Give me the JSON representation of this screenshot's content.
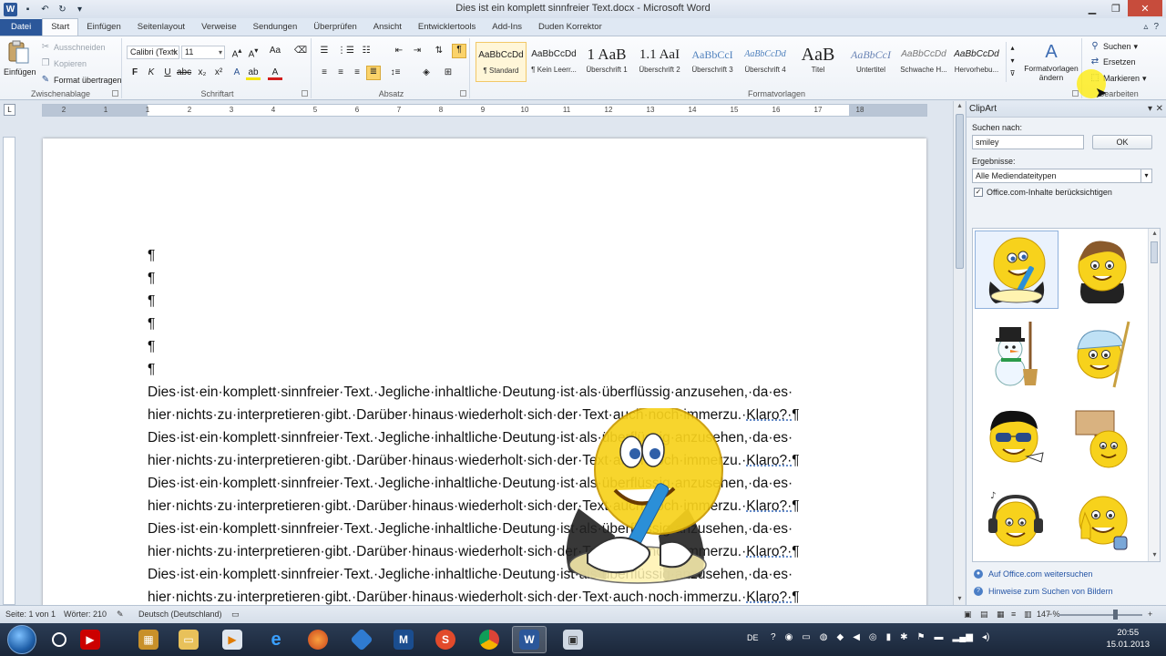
{
  "window": {
    "title": "Dies ist ein komplett sinnfreier Text.docx - Microsoft Word",
    "app_icon": "W"
  },
  "tabs": [
    "Datei",
    "Start",
    "Einfügen",
    "Seitenlayout",
    "Verweise",
    "Sendungen",
    "Überprüfen",
    "Ansicht",
    "Entwicklertools",
    "Add-Ins",
    "Duden Korrektor"
  ],
  "ribbon": {
    "clipboard": {
      "label": "Zwischenablage",
      "paste": "Einfügen",
      "cut": "Ausschneiden",
      "copy": "Kopieren",
      "format_painter": "Format übertragen"
    },
    "font": {
      "label": "Schriftart",
      "font_name": "Calibri (Textk",
      "font_size": "11"
    },
    "paragraph": {
      "label": "Absatz"
    },
    "styles": {
      "label": "Formatvorlagen",
      "items": [
        {
          "sample": "AaBbCcDd",
          "name": "¶ Standard"
        },
        {
          "sample": "AaBbCcDd",
          "name": "¶ Kein Leerr..."
        },
        {
          "sample": "1 AaB",
          "name": "Überschrift 1"
        },
        {
          "sample": "1.1 AaI",
          "name": "Überschrift 2"
        },
        {
          "sample": "AaBbCcI",
          "name": "Überschrift 3"
        },
        {
          "sample": "AaBbCcDd",
          "name": "Überschrift 4"
        },
        {
          "sample": "AaB",
          "name": "Titel"
        },
        {
          "sample": "AaBbCcI",
          "name": "Untertitel"
        },
        {
          "sample": "AaBbCcDd",
          "name": "Schwache H..."
        },
        {
          "sample": "AaBbCcDd",
          "name": "Hervorhebu..."
        }
      ],
      "change_styles": "Formatvorlagen ändern"
    },
    "editing": {
      "label": "Bearbeiten",
      "find": "Suchen",
      "replace": "Ersetzen",
      "select": "Markieren"
    }
  },
  "ruler": {
    "labels": [
      "2",
      "1",
      "1",
      "2",
      "3",
      "4",
      "5",
      "6",
      "7",
      "8",
      "9",
      "10",
      "11",
      "12",
      "13",
      "14",
      "15",
      "16",
      "17",
      "18"
    ]
  },
  "document": {
    "empty_paragraphs": [
      "¶",
      "¶",
      "¶",
      "¶",
      "¶",
      "¶"
    ],
    "lines": [
      {
        "text": "Dies·ist·ein·komplett·sinnfreier·Text.·Jegliche·inhaltliche·Deutung·ist·als·überflüssig·anzusehen,·da·es·",
        "end": ""
      },
      {
        "text": "hier·nichts·zu·interpretieren·gibt.·Darüber·hinaus·wiederholt·sich·der·Text·auch·noch·immerzu.·",
        "end": "Klaro?·¶"
      },
      {
        "text": "Dies·ist·ein·komplett·sinnfreier·Text.·Jegliche·inhaltliche·Deutung·ist·als·überflüssig·anzusehen,·da·es·",
        "end": ""
      },
      {
        "text": "hier·nichts·zu·interpretieren·gibt.·Darüber·hinaus·wiederholt·sich·der·Text·auch·noch·immerzu.·",
        "end": "Klaro?·¶"
      },
      {
        "text": "Dies·ist·ein·komplett·sinnfreier·Text.·Jegliche·inhaltliche·Deutung·ist·als·überflüssig·anzusehen,·da·es·",
        "end": ""
      },
      {
        "text": "hier·nichts·zu·interpretieren·gibt.·Darüber·hinaus·wiederholt·sich·der·Text·auch·noch·immerzu.·",
        "end": "Klaro?·¶"
      },
      {
        "text": "Dies·ist·ein·komplett·sinnfreier·Text.·Jegliche·inhaltliche·Deutung·ist·als·überflüssig·anzusehen,·da·es·",
        "end": ""
      },
      {
        "text": "hier·nichts·zu·interpretieren·gibt.·Darüber·hinaus·wiederholt·sich·der·Text·auch·noch·immerzu.·",
        "end": "Klaro?·¶"
      },
      {
        "text": "Dies·ist·ein·komplett·sinnfreier·Text.·Jegliche·inhaltliche·Deutung·ist·als·überflüssig·anzusehen,·da·es·",
        "end": ""
      },
      {
        "text": "hier·nichts·zu·interpretieren·gibt.·Darüber·hinaus·wiederholt·sich·der·Text·auch·noch·immerzu.·",
        "end": "Klaro?·¶"
      }
    ]
  },
  "clipart_pane": {
    "title": "ClipArt",
    "search_label": "Suchen nach:",
    "search_value": "smiley",
    "ok_button": "OK",
    "results_label": "Ergebnisse:",
    "results_value": "Alle Mediendateitypen",
    "include_online": "Office.com-Inhalte berücksichtigen",
    "include_online_checked": true,
    "thumbnails": [
      "smiley-writing-icon",
      "smiley-with-hair-icon",
      "snowman-smiley-icon",
      "smiley-with-cap-icon",
      "smiley-sunglasses-icon",
      "smiley-with-sign-icon",
      "smiley-headphones-icon",
      "smiley-thumbs-up-icon"
    ],
    "link_more": "Auf Office.com weitersuchen",
    "link_hints": "Hinweise zum Suchen von Bildern"
  },
  "statusbar": {
    "page": "Seite: 1 von 1",
    "words": "Wörter: 210",
    "language": "Deutsch (Deutschland)",
    "zoom": "147 %"
  },
  "taskbar": {
    "input_lang": "DE",
    "time": "20:55",
    "date": "15.01.2013"
  },
  "colors": {
    "file_tab": "#2b579a",
    "smiley_yellow": "#f7d21c",
    "link_blue": "#2454a5"
  }
}
